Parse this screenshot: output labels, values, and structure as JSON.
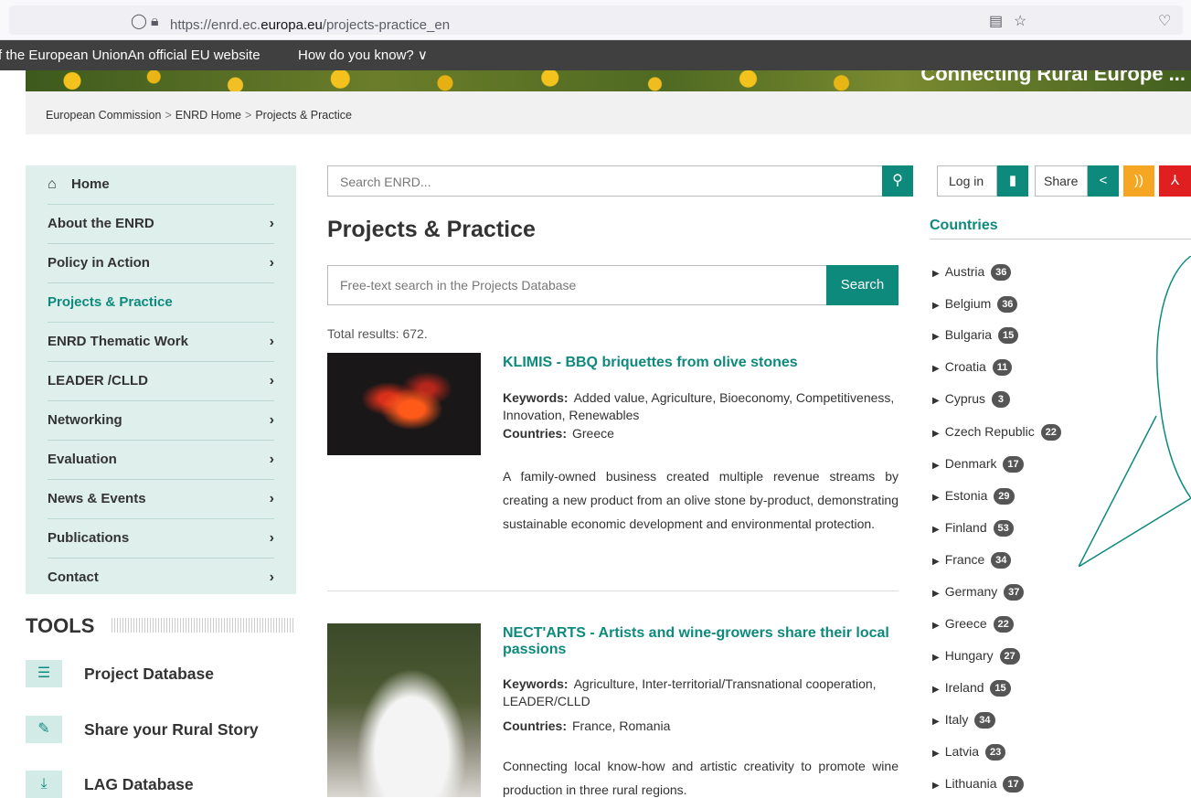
{
  "browser": {
    "url_prefix": "https://enrd.ec.",
    "url_domain": "europa.eu",
    "url_path": "/projects-practice_en"
  },
  "eu_banner": {
    "left_text": "f the European UnionAn official EU website",
    "how_text": "How do you know? ∨"
  },
  "hero": {
    "title": "Connecting Rural Europe ..."
  },
  "breadcrumb": {
    "items": [
      "European Commission",
      "ENRD Home",
      "Projects & Practice"
    ],
    "separator": ">"
  },
  "sidebar": {
    "home": "Home",
    "items": [
      {
        "label": "About the ENRD",
        "active": false
      },
      {
        "label": "Policy in Action",
        "active": false
      },
      {
        "label": "Projects & Practice",
        "active": true
      },
      {
        "label": "ENRD Thematic Work",
        "active": false
      },
      {
        "label": "LEADER /CLLD",
        "active": false
      },
      {
        "label": "Networking",
        "active": false
      },
      {
        "label": "Evaluation",
        "active": false
      },
      {
        "label": "News & Events",
        "active": false
      },
      {
        "label": "Publications",
        "active": false
      },
      {
        "label": "Contact",
        "active": false
      }
    ]
  },
  "tools": {
    "heading": "TOOLS",
    "items": [
      {
        "label": "Project Database",
        "icon": "database-icon"
      },
      {
        "label": "Share your Rural Story",
        "icon": "chat-icon"
      },
      {
        "label": "LAG Database",
        "icon": "download-file-icon"
      }
    ]
  },
  "search": {
    "placeholder": "Search ENRD..."
  },
  "main": {
    "title": "Projects & Practice",
    "db_search_placeholder": "Free-text search in the Projects Database",
    "db_search_button": "Search",
    "total": "Total results: 672.",
    "keywords_label": "Keywords:",
    "countries_label": "Countries:",
    "results": [
      {
        "title": "KLIMIS - BBQ briquettes from olive stones",
        "keywords": "Added value, Agriculture, Bioeconomy, Competitiveness, Innovation, Renewables",
        "countries": "Greece",
        "description": "A family-owned business created multiple revenue streams by creating a new product from an olive stone by-product, demonstrating sustainable economic development and environmental protection."
      },
      {
        "title": "NECT'ARTS - Artists and wine-growers share their local passions",
        "keywords": "Agriculture, Inter-territorial/Transnational cooperation, LEADER/CLLD",
        "countries": "France, Romania",
        "description": "Connecting local know-how and artistic creativity to promote wine production in three rural regions."
      }
    ]
  },
  "right": {
    "login": "Log in",
    "share": "Share",
    "countries_heading": "Countries",
    "countries": [
      {
        "name": "Austria",
        "count": "36"
      },
      {
        "name": "Belgium",
        "count": "36"
      },
      {
        "name": "Bulgaria",
        "count": "15"
      },
      {
        "name": "Croatia",
        "count": "11"
      },
      {
        "name": "Cyprus",
        "count": "3"
      },
      {
        "name": "Czech Republic",
        "count": "22"
      },
      {
        "name": "Denmark",
        "count": "17"
      },
      {
        "name": "Estonia",
        "count": "29"
      },
      {
        "name": "Finland",
        "count": "53"
      },
      {
        "name": "France",
        "count": "34"
      },
      {
        "name": "Germany",
        "count": "37"
      },
      {
        "name": "Greece",
        "count": "22"
      },
      {
        "name": "Hungary",
        "count": "27"
      },
      {
        "name": "Ireland",
        "count": "15"
      },
      {
        "name": "Italy",
        "count": "34"
      },
      {
        "name": "Latvia",
        "count": "23"
      },
      {
        "name": "Lithuania",
        "count": "17"
      }
    ]
  },
  "colors": {
    "accent": "#0e8a7d",
    "sidebar_bg": "#dfefec",
    "banner_bg": "#404040",
    "rss": "#f5a623",
    "pdf": "#e02020"
  }
}
